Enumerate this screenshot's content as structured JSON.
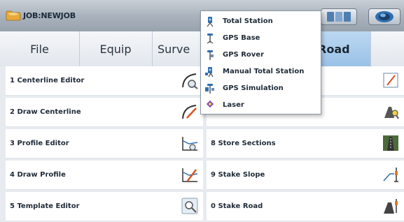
{
  "title_bar": {
    "job_title": "JOB:NEWJOB"
  },
  "menu_tabs": [
    "File",
    "Equip",
    "Surve",
    "Road"
  ],
  "menu_tab_active": "Road",
  "road_menu": {
    "left": [
      "1 Centerline Editor",
      "2 Draw Centerline",
      "3 Profile Editor",
      "4 Draw Profile",
      "5 Template Editor"
    ],
    "right": [
      "",
      "",
      "8 Store Sections",
      "9 Stake Slope",
      "0 Stake Road"
    ]
  },
  "equip_dropdown": [
    {
      "label": "Total Station",
      "icon": "total-station-icon"
    },
    {
      "label": "GPS Base",
      "icon": "gps-base-icon"
    },
    {
      "label": "GPS Rover",
      "icon": "gps-rover-icon"
    },
    {
      "label": "Manual Total Station",
      "icon": "manual-total-station-icon"
    },
    {
      "label": "GPS Simulation",
      "icon": "gps-simulation-icon"
    },
    {
      "label": "Laser",
      "icon": "laser-icon"
    }
  ],
  "colors": {
    "active_tab": "#9fc4e8",
    "title_bar": "#aab3bd",
    "text": "#1f2b38"
  }
}
